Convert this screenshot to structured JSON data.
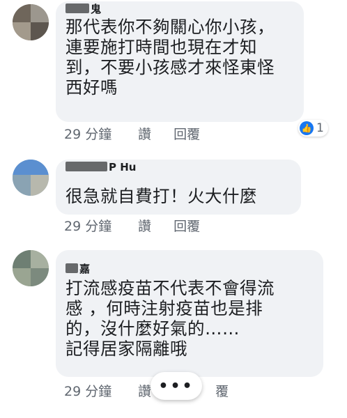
{
  "comments": [
    {
      "author_visible": "鬼",
      "lines": [
        "那代表你不夠關心你小孩，",
        "連要施打時間也現在才知",
        "到，不要小孩感才來怪東怪",
        "西好嗎"
      ],
      "time": "29 分鐘",
      "like_label": "讚",
      "reply_label": "回覆",
      "reaction_count": "1",
      "reaction_icon": "like-thumb-icon"
    },
    {
      "author_visible": "P Hu",
      "lines": [
        "很急就自費打！火大什麼"
      ],
      "time": "29 分鐘",
      "like_label": "讚",
      "reply_label": "回覆"
    },
    {
      "author_visible": "嘉",
      "lines": [
        "打流感疫苗不代表不會得流",
        "感 ，何時注射疫苗也是排",
        "的，沒什麼好氣的……",
        "記得居家隔離哦"
      ],
      "time": "29 分鐘",
      "like_label": "讚",
      "reply_label": "覆"
    }
  ],
  "more_button": {
    "label": "•••"
  },
  "colors": {
    "bubble": "#f0f2f5",
    "text": "#1c1e21",
    "meta": "#606770",
    "like_blue": "#1877f2"
  }
}
